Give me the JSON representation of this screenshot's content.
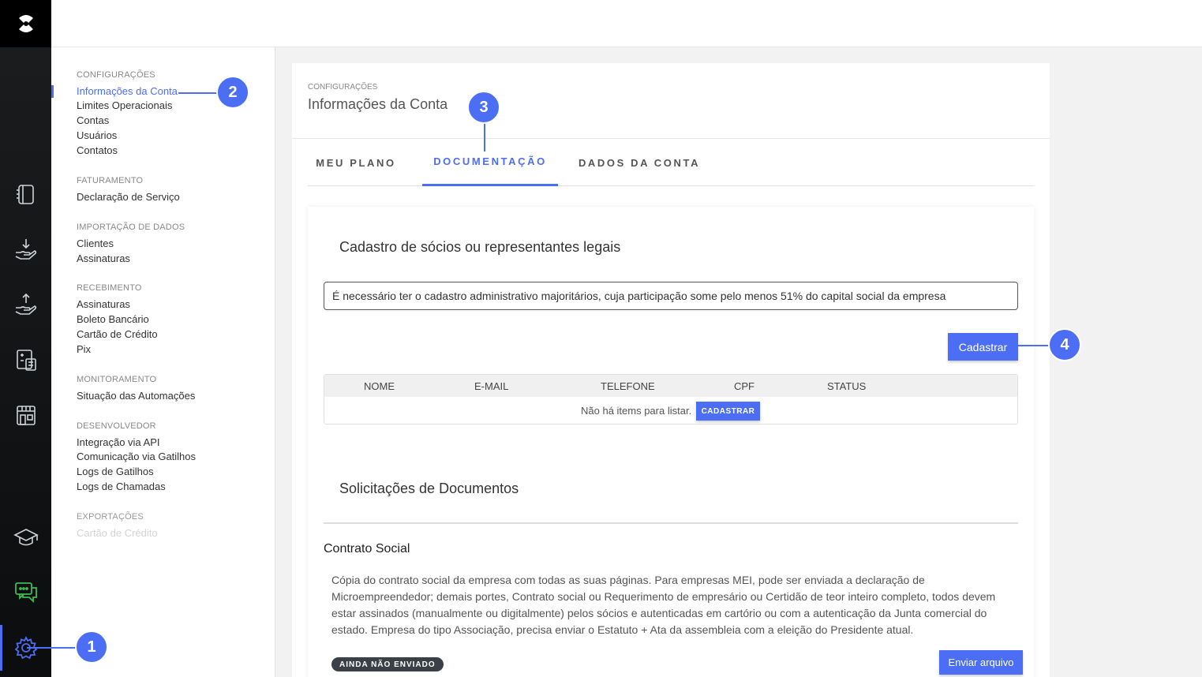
{
  "submenu": {
    "sections": [
      {
        "heading": "CONFIGURAÇÕES",
        "items": [
          "Informações da Conta",
          "Limites Operacionais",
          "Contas",
          "Usuários",
          "Contatos"
        ]
      },
      {
        "heading": "FATURAMENTO",
        "items": [
          "Declaração de Serviço"
        ]
      },
      {
        "heading": "IMPORTAÇÃO DE DADOS",
        "items": [
          "Clientes",
          "Assinaturas"
        ]
      },
      {
        "heading": "RECEBIMENTO",
        "items": [
          "Assinaturas",
          "Boleto Bancário",
          "Cartão de Crédito",
          "Pix"
        ]
      },
      {
        "heading": "MONITORAMENTO",
        "items": [
          "Situação das Automações"
        ]
      },
      {
        "heading": "DESENVOLVEDOR",
        "items": [
          "Integração via API",
          "Comunicação via Gatilhos",
          "Logs de Gatilhos",
          "Logs de Chamadas"
        ]
      },
      {
        "heading": "EXPORTAÇÕES",
        "items": [
          "Cartão de Crédito"
        ]
      }
    ]
  },
  "page": {
    "breadcrumb": "CONFIGURAÇÕES",
    "title": "Informações da Conta",
    "tabs": [
      "MEU PLANO",
      "DOCUMENTAÇÃO",
      "DADOS DA CONTA"
    ],
    "active_tab": "DOCUMENTAÇÃO"
  },
  "socios": {
    "title": "Cadastro de sócios ou representantes legais",
    "notice": "É necessário ter o cadastro administrativo majoritários, cuja participação some pelo menos 51% do capital social da empresa",
    "register_button": "Cadastrar",
    "columns": [
      "NOME",
      "E-MAIL",
      "TELEFONE",
      "CPF",
      "STATUS"
    ],
    "empty_text": "Não há items para listar.",
    "empty_button": "CADASTRAR"
  },
  "documents": {
    "title": "Solicitações de Documentos",
    "item_title": "Contrato Social",
    "item_desc": "Cópia do contrato social da empresa com todas as suas páginas. Para empresas MEI, pode ser enviada a declaração de Microempreendedor; demais portes, Contrato social ou Requerimento de empresário ou Certidão de teor inteiro completo, todos devem estar assinados (manualmente ou digitalmente) pelos sócios e autenticadas em cartório ou com a autenticação da Junta comercial do estado. Empresa do tipo Associação, precisa enviar o Estatuto + Ata da assembleia com a eleição do Presidente atual.",
    "status_badge": "AINDA NÃO ENVIADO",
    "upload_button": "Enviar arquivo"
  },
  "callouts": [
    "1",
    "2",
    "3",
    "4"
  ],
  "colors": {
    "accent": "#4c6ef5",
    "rail": "#111213",
    "badge": "#3b4047",
    "chat_icon": "#3fb950"
  },
  "rail_icons": [
    "logo-icon",
    "notebook-icon",
    "hand-receive-icon",
    "hand-pay-icon",
    "calculator-doc-icon",
    "store-icon",
    "graduation-cap-icon",
    "chat-icon",
    "gear-icon"
  ]
}
